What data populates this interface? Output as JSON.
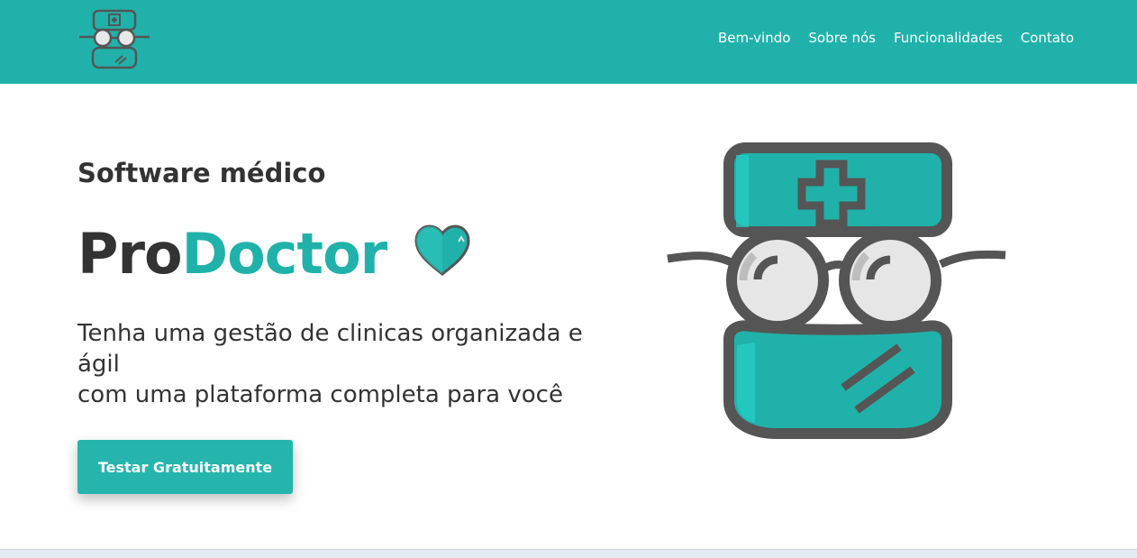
{
  "brand": {
    "logo_icon": "doctor-face-icon",
    "primary_color": "#20b2aa",
    "dark_color": "#333333"
  },
  "nav": {
    "items": [
      {
        "label": "Bem-vindo"
      },
      {
        "label": "Sobre nós"
      },
      {
        "label": "Funcionalidades"
      },
      {
        "label": "Contato"
      }
    ]
  },
  "hero": {
    "subtitle": "Software médico",
    "title_part1": "Pro",
    "title_part2": "Doctor",
    "heart_icon": "heart-icon",
    "text_line1": "Tenha uma gestão de clinicas organizada e ágil",
    "text_line2": "com uma plataforma completa para você",
    "cta_label": "Testar Gratuitamente",
    "illustration_icon": "doctor-face-illustration"
  }
}
